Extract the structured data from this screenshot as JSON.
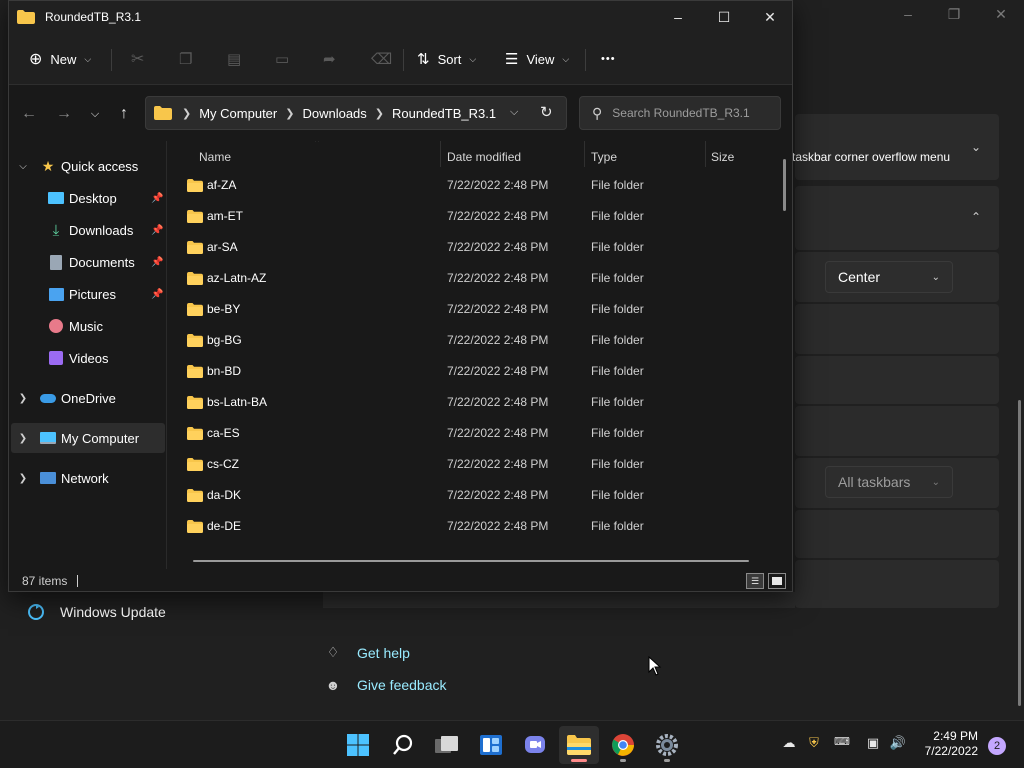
{
  "explorer": {
    "title": "RoundedTB_R3.1",
    "toolbar": {
      "new_label": "New",
      "sort_label": "Sort",
      "view_label": "View",
      "more_label": "•••"
    },
    "breadcrumbs": [
      "My Computer",
      "Downloads",
      "RoundedTB_R3.1"
    ],
    "search_placeholder": "Search RoundedTB_R3.1",
    "nav": {
      "quick_access": "Quick access",
      "desktop": "Desktop",
      "downloads": "Downloads",
      "documents": "Documents",
      "pictures": "Pictures",
      "music": "Music",
      "videos": "Videos",
      "onedrive": "OneDrive",
      "my_computer": "My Computer",
      "network": "Network"
    },
    "columns": {
      "name": "Name",
      "date": "Date modified",
      "type": "Type",
      "size": "Size"
    },
    "rows": [
      {
        "name": "af-ZA",
        "date": "7/22/2022 2:48 PM",
        "type": "File folder"
      },
      {
        "name": "am-ET",
        "date": "7/22/2022 2:48 PM",
        "type": "File folder"
      },
      {
        "name": "ar-SA",
        "date": "7/22/2022 2:48 PM",
        "type": "File folder"
      },
      {
        "name": "az-Latn-AZ",
        "date": "7/22/2022 2:48 PM",
        "type": "File folder"
      },
      {
        "name": "be-BY",
        "date": "7/22/2022 2:48 PM",
        "type": "File folder"
      },
      {
        "name": "bg-BG",
        "date": "7/22/2022 2:48 PM",
        "type": "File folder"
      },
      {
        "name": "bn-BD",
        "date": "7/22/2022 2:48 PM",
        "type": "File folder"
      },
      {
        "name": "bs-Latn-BA",
        "date": "7/22/2022 2:48 PM",
        "type": "File folder"
      },
      {
        "name": "ca-ES",
        "date": "7/22/2022 2:48 PM",
        "type": "File folder"
      },
      {
        "name": "cs-CZ",
        "date": "7/22/2022 2:48 PM",
        "type": "File folder"
      },
      {
        "name": "da-DK",
        "date": "7/22/2022 2:48 PM",
        "type": "File folder"
      },
      {
        "name": "de-DE",
        "date": "7/22/2022 2:48 PM",
        "type": "File folder"
      }
    ],
    "status": "87 items"
  },
  "settings": {
    "overflow_label": "taskbar corner overflow menu",
    "alignment_value": "Center",
    "multi_display_value": "All taskbars",
    "windows_update": "Windows Update",
    "get_help": "Get help",
    "give_feedback": "Give feedback"
  },
  "taskbar": {
    "time": "2:49 PM",
    "date": "7/22/2022",
    "notification_count": "2"
  },
  "colors": {
    "accent": "#4cc2ff",
    "folder": "#f8c64b",
    "link": "#99ebff"
  }
}
